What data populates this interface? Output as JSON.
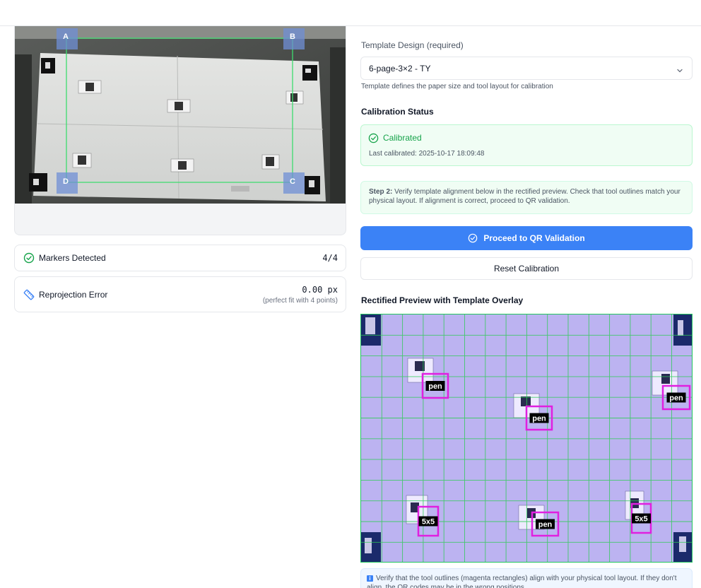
{
  "camera": {
    "marker_labels": [
      "A",
      "B",
      "C",
      "D"
    ]
  },
  "metrics": {
    "markers": {
      "label": "Markers Detected",
      "value": "4/4",
      "icon": "check-circle-icon"
    },
    "reprojection": {
      "label": "Reprojection Error",
      "value": "0.00 px",
      "note": "(perfect fit with 4 points)",
      "icon": "ruler-icon"
    }
  },
  "template": {
    "label": "Template Design (required)",
    "selected": "6-page-3×2 - TY",
    "helper": "Template defines the paper size and tool layout for calibration"
  },
  "calibration": {
    "title": "Calibration Status",
    "status": "Calibrated",
    "last": "Last calibrated: 2025-10-17 18:09:48"
  },
  "step": {
    "prefix": "Step 2:",
    "text": "Verify template alignment below in the rectified preview. Check that tool outlines match your physical layout. If alignment is correct, proceed to QR validation."
  },
  "buttons": {
    "proceed": "Proceed to QR Validation",
    "reset": "Reset Calibration"
  },
  "preview": {
    "title": "Rectified Preview with Template Overlay",
    "tools": [
      "pen",
      "pen",
      "pen",
      "5x5",
      "pen",
      "5x5"
    ]
  },
  "info": {
    "text": "Verify that the tool outlines (magenta rectangles) align with your physical tool layout. If they don't align, the QR codes may be in the wrong positions."
  },
  "colors": {
    "accent": "#3b82f6",
    "success": "#16a34a",
    "overlay_magenta": "#e020e0",
    "grid_green": "#22c55e"
  }
}
